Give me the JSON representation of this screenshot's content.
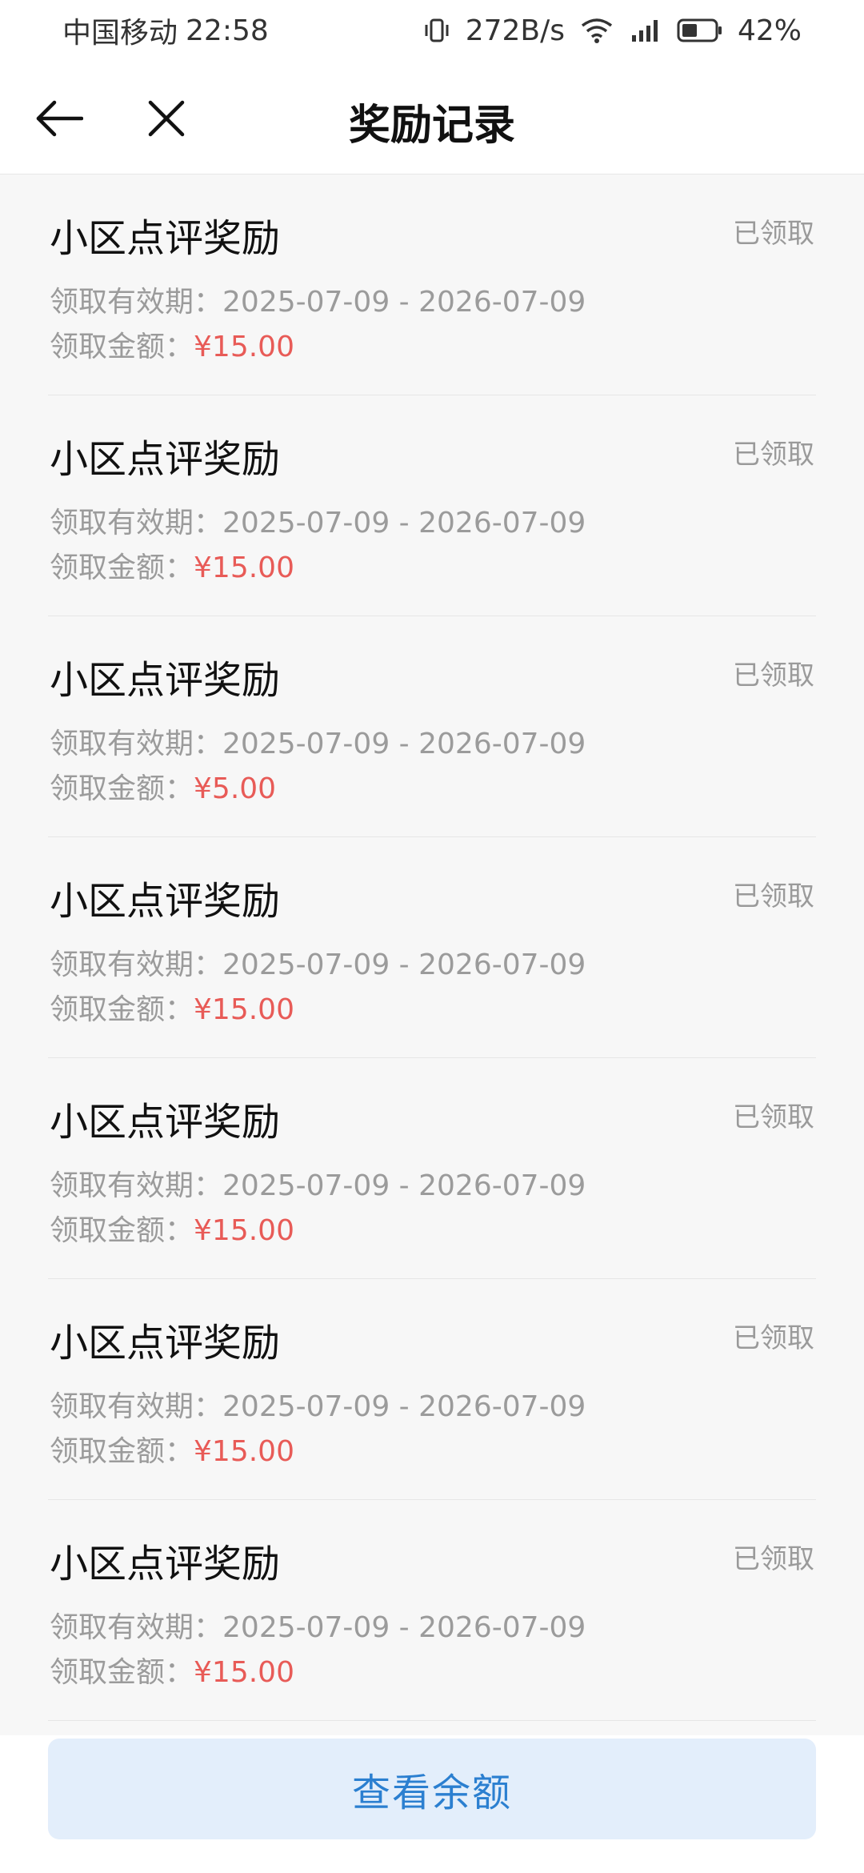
{
  "status_bar": {
    "carrier": "中国移动",
    "time": "22:58",
    "net_speed": "272B/s",
    "battery": "42%"
  },
  "header": {
    "title": "奖励记录"
  },
  "list": {
    "validity_label": "领取有效期：",
    "amount_label": "领取金额：",
    "items": [
      {
        "name": "小区点评奖励",
        "status": "已领取",
        "validity": "2025-07-09 - 2026-07-09",
        "amount": "¥15.00"
      },
      {
        "name": "小区点评奖励",
        "status": "已领取",
        "validity": "2025-07-09 - 2026-07-09",
        "amount": "¥15.00"
      },
      {
        "name": "小区点评奖励",
        "status": "已领取",
        "validity": "2025-07-09 - 2026-07-09",
        "amount": "¥5.00"
      },
      {
        "name": "小区点评奖励",
        "status": "已领取",
        "validity": "2025-07-09 - 2026-07-09",
        "amount": "¥15.00"
      },
      {
        "name": "小区点评奖励",
        "status": "已领取",
        "validity": "2025-07-09 - 2026-07-09",
        "amount": "¥15.00"
      },
      {
        "name": "小区点评奖励",
        "status": "已领取",
        "validity": "2025-07-09 - 2026-07-09",
        "amount": "¥15.00"
      },
      {
        "name": "小区点评奖励",
        "status": "已领取",
        "validity": "2025-07-09 - 2026-07-09",
        "amount": "¥15.00"
      }
    ]
  },
  "footer": {
    "balance_button": "查看余额"
  },
  "colors": {
    "amount": "#e85b57",
    "button_bg": "#e3eefb",
    "button_text": "#2b7fd0"
  },
  "icons": {
    "back": "arrow-left-icon",
    "close": "close-icon",
    "vibrate": "vibrate-icon",
    "wifi": "wifi-icon",
    "signal": "signal-icon",
    "battery": "battery-icon"
  }
}
